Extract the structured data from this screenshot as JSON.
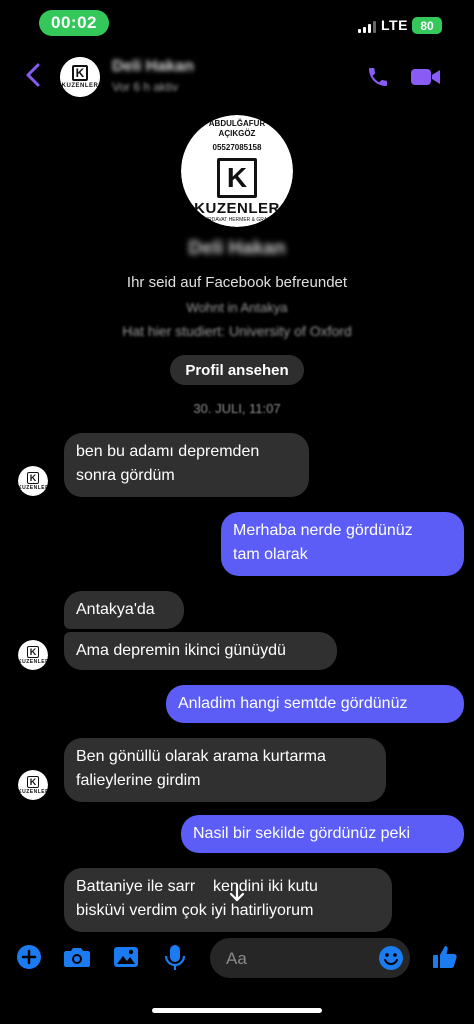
{
  "status_bar": {
    "time": "00:02",
    "network": "LTE",
    "battery": "80"
  },
  "header": {
    "name": "Deli Hakan",
    "status": "Vor 6 h aktiv"
  },
  "logo": {
    "line1": "ABDULĞAFUR",
    "line2": "AÇIKGÖZ",
    "phone": "05527085158",
    "letter": "K",
    "brand": "KUZENLER",
    "sub": "HIRDAVAT HERMER & GRAN"
  },
  "profile": {
    "name": "Deli Hakan",
    "friends": "Ihr seid auf Facebook befreundet",
    "lives": "Wohnt in Antakya",
    "studied": "Hat hier studiert: University of Oxford",
    "view_profile_label": "Profil ansehen",
    "timestamp": "30. JULI, 11:07"
  },
  "messages": [
    {
      "dir": "in",
      "lines": [
        "ben bu adamı depremden",
        "sonra gördüm"
      ]
    },
    {
      "dir": "out",
      "lines": [
        "Merhaba nerde gördünüz",
        "tam olarak"
      ]
    },
    {
      "dir": "in",
      "lines": [
        "Antakya'da"
      ]
    },
    {
      "dir": "in",
      "lines": [
        "Ama depremin ikinci günüydü"
      ]
    },
    {
      "dir": "out",
      "lines": [
        "Anladim hangi semtde gördünüz"
      ]
    },
    {
      "dir": "in",
      "lines": [
        "Ben gönüllü olarak arama kurtarma",
        "falieylerine girdim"
      ]
    },
    {
      "dir": "out",
      "lines": [
        "Nasil bir sekilde gördünüz peki"
      ]
    },
    {
      "dir": "in",
      "lines": [
        "Battaniye ile sarr    kendini iki kutu",
        "bisküvi verdim çok iyi hatirliyorum"
      ]
    }
  ],
  "composer": {
    "placeholder": "Aa"
  },
  "icons": {
    "back": "chevron-left-icon",
    "call": "phone-icon",
    "video": "video-camera-icon",
    "add": "plus-circle-icon",
    "camera": "camera-icon",
    "gallery": "image-icon",
    "mic": "microphone-icon",
    "emoji": "smiley-icon",
    "like": "thumbs-up-icon",
    "scroll": "arrow-down-icon"
  },
  "colors": {
    "accent": "#8a5cf6",
    "outgoing_bubble": "#5b5df6",
    "incoming_bubble": "#303030",
    "composer_blue": "#1b7cf2",
    "timer_green": "#34c759"
  }
}
